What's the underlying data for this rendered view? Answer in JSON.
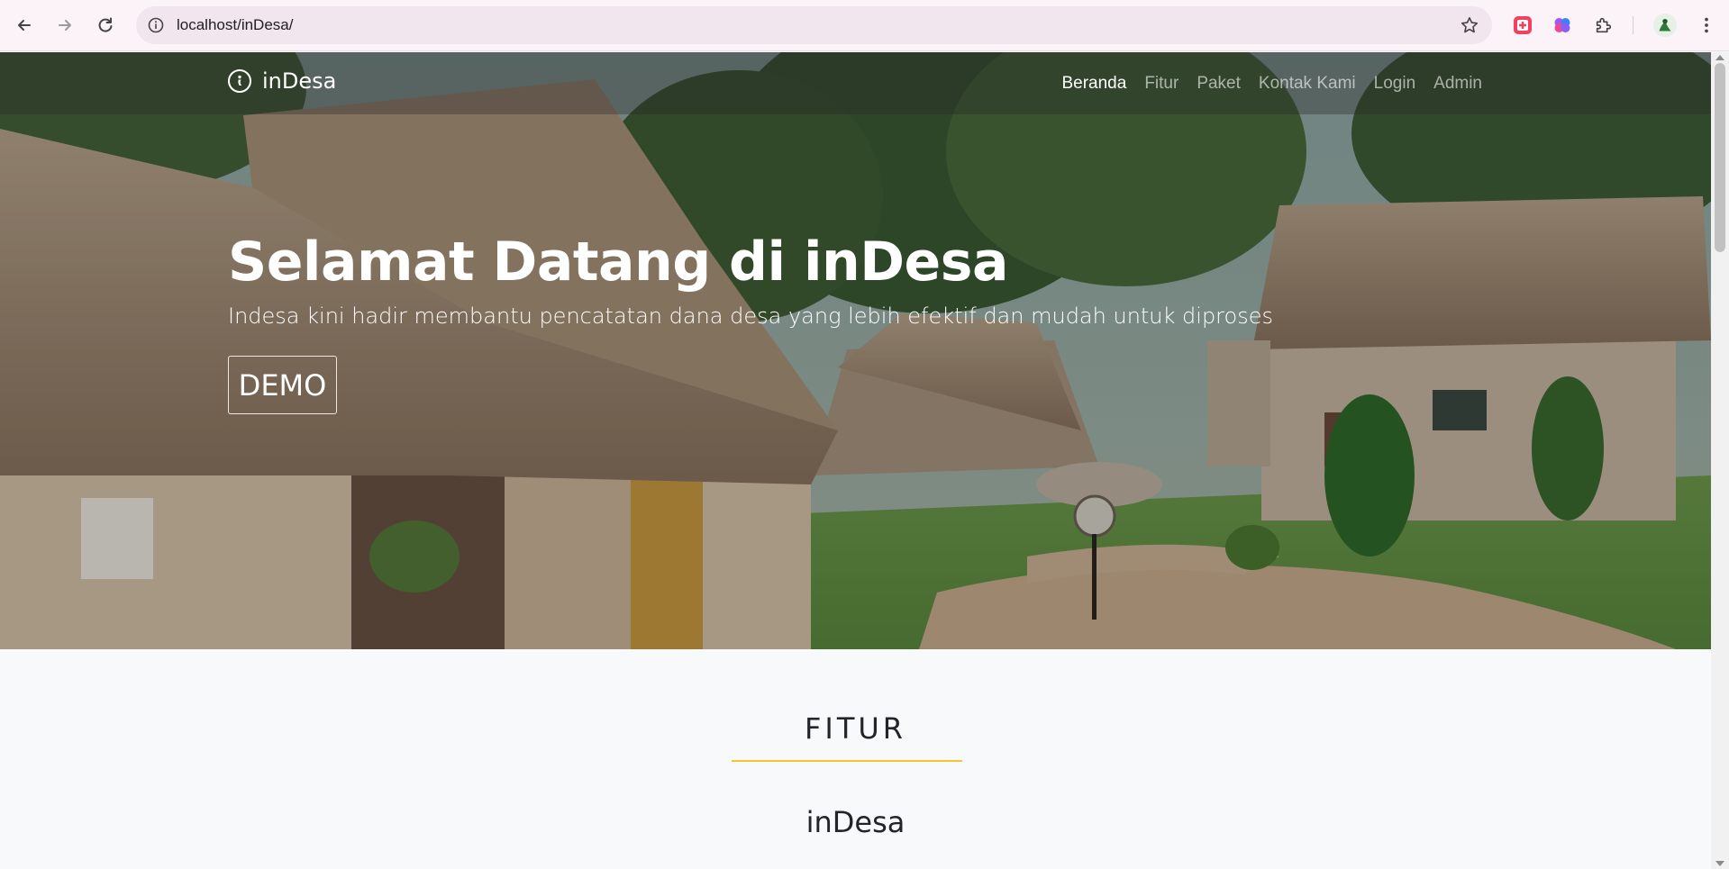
{
  "browser": {
    "url": "localhost/inDesa/"
  },
  "navbar": {
    "brand": "inDesa",
    "items": [
      {
        "label": "Beranda",
        "active": true
      },
      {
        "label": "Fitur",
        "active": false
      },
      {
        "label": "Paket",
        "active": false
      },
      {
        "label": "Kontak Kami",
        "active": false
      },
      {
        "label": "Login",
        "active": false
      },
      {
        "label": "Admin",
        "active": false
      }
    ]
  },
  "hero": {
    "title": "Selamat Datang di inDesa",
    "subtitle": "Indesa kini hadir membantu pencatatan dana desa yang lebih efektif dan mudah untuk diproses",
    "button": "DEMO"
  },
  "features": {
    "heading": "FITUR",
    "subheading": "inDesa"
  },
  "colors": {
    "accent": "#f6c431",
    "text": "#212529",
    "page_bg": "#f8f9fa"
  }
}
